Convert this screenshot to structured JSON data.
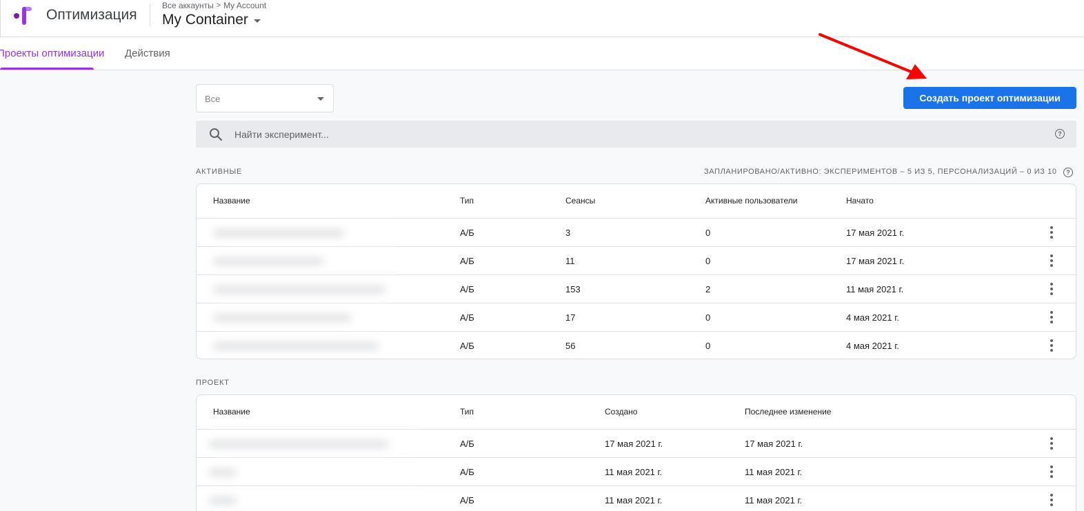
{
  "app": {
    "product_name": "Оптимизация",
    "breadcrumb_root": "Все аккаунты",
    "breadcrumb_separator": ">",
    "breadcrumb_account": "My Account",
    "container_name": "My Container",
    "logo_colors": [
      "#9334e6",
      "#b77df0",
      "#7b1fa2"
    ]
  },
  "tabs": [
    {
      "label": "Проекты оптимизации",
      "active": true
    },
    {
      "label": "Действия",
      "active": false
    }
  ],
  "filter": {
    "selected": "Все"
  },
  "create_button": {
    "label": "Создать проект оптимизации"
  },
  "search": {
    "placeholder": "Найти эксперимент..."
  },
  "active_section": {
    "label": "АКТИВНЫЕ",
    "quota": "ЗАПЛАНИРОВАНО/АКТИВНО: ЭКСПЕРИМЕНТОВ – 5 ИЗ 5, ПЕРСОНАЛИЗАЦИЙ – 0 ИЗ 10",
    "columns": {
      "name": "Название",
      "type": "Тип",
      "sessions": "Сеансы",
      "active_users": "Активные пользователи",
      "started": "Начато"
    },
    "rows": [
      {
        "type": "А/Б",
        "sessions": "3",
        "active_users": "0",
        "started": "17 мая 2021 г."
      },
      {
        "type": "А/Б",
        "sessions": "11",
        "active_users": "0",
        "started": "17 мая 2021 г."
      },
      {
        "type": "А/Б",
        "sessions": "153",
        "active_users": "2",
        "started": "11 мая 2021 г."
      },
      {
        "type": "А/Б",
        "sessions": "17",
        "active_users": "0",
        "started": "4 мая 2021 г."
      },
      {
        "type": "А/Б",
        "sessions": "56",
        "active_users": "0",
        "started": "4 мая 2021 г."
      }
    ]
  },
  "draft_section": {
    "label": "ПРОЕКТ",
    "columns": {
      "name": "Название",
      "type": "Тип",
      "created": "Создано",
      "modified": "Последнее изменение"
    },
    "rows": [
      {
        "type": "А/Б",
        "created": "17 мая 2021 г.",
        "modified": "17 мая 2021 г."
      },
      {
        "type": "А/Б",
        "created": "11 мая 2021 г.",
        "modified": "11 мая 2021 г."
      },
      {
        "type": "А/Б",
        "created": "11 мая 2021 г.",
        "modified": "11 мая 2021 г."
      }
    ]
  },
  "colors": {
    "accent": "#9334e6",
    "primary_button": "#1a73e8",
    "annotation_arrow": "#ff0000"
  }
}
